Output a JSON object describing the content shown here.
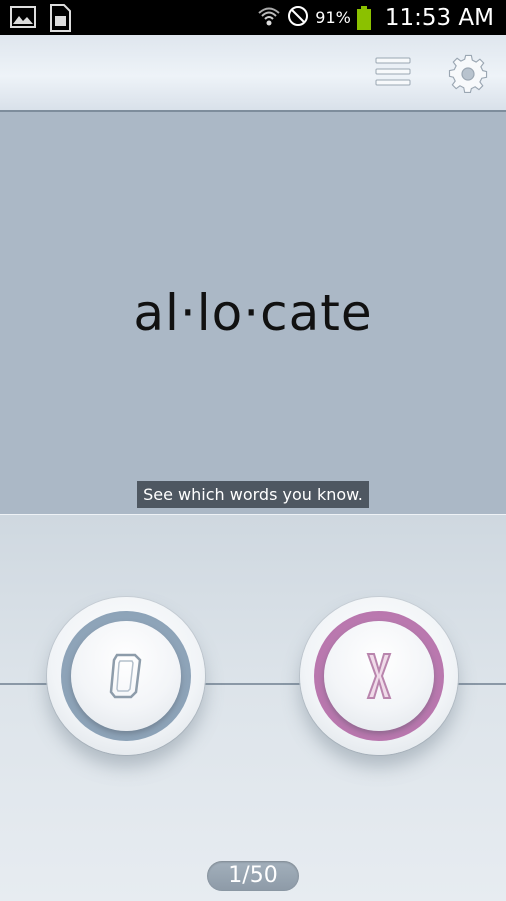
{
  "status_bar": {
    "battery_percent": "91%",
    "time": "11:53 AM",
    "icons": [
      "image-icon",
      "sim-card-icon",
      "wifi-icon",
      "no-signal-icon",
      "battery-icon"
    ],
    "battery_color": "#8bc100"
  },
  "action_bar": {
    "menu_icon": "menu-icon",
    "settings_icon": "gear-icon"
  },
  "card": {
    "word": "al·lo·cate",
    "hint": "See which words you know."
  },
  "buttons": {
    "know_label": "O",
    "dont_know_label": "X",
    "know_color": "#8da3b8",
    "dont_know_color": "#b977ae"
  },
  "progress": {
    "counter": "1/50"
  }
}
